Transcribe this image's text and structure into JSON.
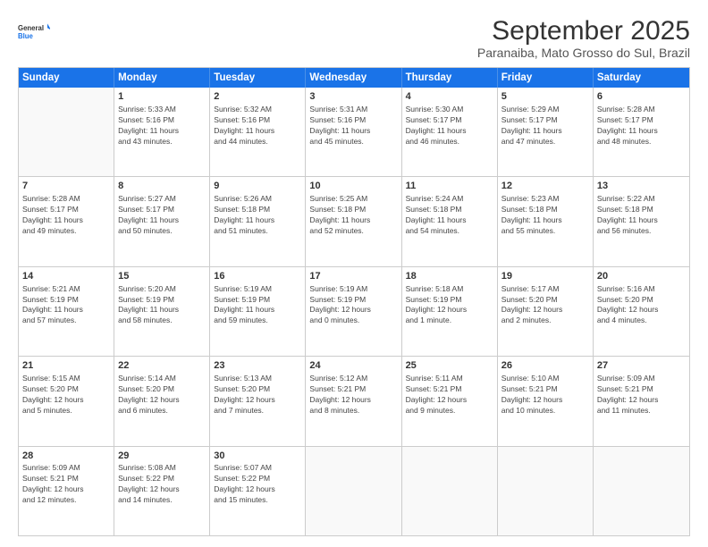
{
  "logo": {
    "line1": "General",
    "line2": "Blue"
  },
  "title": "September 2025",
  "location": "Paranaiba, Mato Grosso do Sul, Brazil",
  "header_days": [
    "Sunday",
    "Monday",
    "Tuesday",
    "Wednesday",
    "Thursday",
    "Friday",
    "Saturday"
  ],
  "weeks": [
    [
      {
        "day": "",
        "info": ""
      },
      {
        "day": "1",
        "info": "Sunrise: 5:33 AM\nSunset: 5:16 PM\nDaylight: 11 hours\nand 43 minutes."
      },
      {
        "day": "2",
        "info": "Sunrise: 5:32 AM\nSunset: 5:16 PM\nDaylight: 11 hours\nand 44 minutes."
      },
      {
        "day": "3",
        "info": "Sunrise: 5:31 AM\nSunset: 5:16 PM\nDaylight: 11 hours\nand 45 minutes."
      },
      {
        "day": "4",
        "info": "Sunrise: 5:30 AM\nSunset: 5:17 PM\nDaylight: 11 hours\nand 46 minutes."
      },
      {
        "day": "5",
        "info": "Sunrise: 5:29 AM\nSunset: 5:17 PM\nDaylight: 11 hours\nand 47 minutes."
      },
      {
        "day": "6",
        "info": "Sunrise: 5:28 AM\nSunset: 5:17 PM\nDaylight: 11 hours\nand 48 minutes."
      }
    ],
    [
      {
        "day": "7",
        "info": "Sunrise: 5:28 AM\nSunset: 5:17 PM\nDaylight: 11 hours\nand 49 minutes."
      },
      {
        "day": "8",
        "info": "Sunrise: 5:27 AM\nSunset: 5:17 PM\nDaylight: 11 hours\nand 50 minutes."
      },
      {
        "day": "9",
        "info": "Sunrise: 5:26 AM\nSunset: 5:18 PM\nDaylight: 11 hours\nand 51 minutes."
      },
      {
        "day": "10",
        "info": "Sunrise: 5:25 AM\nSunset: 5:18 PM\nDaylight: 11 hours\nand 52 minutes."
      },
      {
        "day": "11",
        "info": "Sunrise: 5:24 AM\nSunset: 5:18 PM\nDaylight: 11 hours\nand 54 minutes."
      },
      {
        "day": "12",
        "info": "Sunrise: 5:23 AM\nSunset: 5:18 PM\nDaylight: 11 hours\nand 55 minutes."
      },
      {
        "day": "13",
        "info": "Sunrise: 5:22 AM\nSunset: 5:18 PM\nDaylight: 11 hours\nand 56 minutes."
      }
    ],
    [
      {
        "day": "14",
        "info": "Sunrise: 5:21 AM\nSunset: 5:19 PM\nDaylight: 11 hours\nand 57 minutes."
      },
      {
        "day": "15",
        "info": "Sunrise: 5:20 AM\nSunset: 5:19 PM\nDaylight: 11 hours\nand 58 minutes."
      },
      {
        "day": "16",
        "info": "Sunrise: 5:19 AM\nSunset: 5:19 PM\nDaylight: 11 hours\nand 59 minutes."
      },
      {
        "day": "17",
        "info": "Sunrise: 5:19 AM\nSunset: 5:19 PM\nDaylight: 12 hours\nand 0 minutes."
      },
      {
        "day": "18",
        "info": "Sunrise: 5:18 AM\nSunset: 5:19 PM\nDaylight: 12 hours\nand 1 minute."
      },
      {
        "day": "19",
        "info": "Sunrise: 5:17 AM\nSunset: 5:20 PM\nDaylight: 12 hours\nand 2 minutes."
      },
      {
        "day": "20",
        "info": "Sunrise: 5:16 AM\nSunset: 5:20 PM\nDaylight: 12 hours\nand 4 minutes."
      }
    ],
    [
      {
        "day": "21",
        "info": "Sunrise: 5:15 AM\nSunset: 5:20 PM\nDaylight: 12 hours\nand 5 minutes."
      },
      {
        "day": "22",
        "info": "Sunrise: 5:14 AM\nSunset: 5:20 PM\nDaylight: 12 hours\nand 6 minutes."
      },
      {
        "day": "23",
        "info": "Sunrise: 5:13 AM\nSunset: 5:20 PM\nDaylight: 12 hours\nand 7 minutes."
      },
      {
        "day": "24",
        "info": "Sunrise: 5:12 AM\nSunset: 5:21 PM\nDaylight: 12 hours\nand 8 minutes."
      },
      {
        "day": "25",
        "info": "Sunrise: 5:11 AM\nSunset: 5:21 PM\nDaylight: 12 hours\nand 9 minutes."
      },
      {
        "day": "26",
        "info": "Sunrise: 5:10 AM\nSunset: 5:21 PM\nDaylight: 12 hours\nand 10 minutes."
      },
      {
        "day": "27",
        "info": "Sunrise: 5:09 AM\nSunset: 5:21 PM\nDaylight: 12 hours\nand 11 minutes."
      }
    ],
    [
      {
        "day": "28",
        "info": "Sunrise: 5:09 AM\nSunset: 5:21 PM\nDaylight: 12 hours\nand 12 minutes."
      },
      {
        "day": "29",
        "info": "Sunrise: 5:08 AM\nSunset: 5:22 PM\nDaylight: 12 hours\nand 14 minutes."
      },
      {
        "day": "30",
        "info": "Sunrise: 5:07 AM\nSunset: 5:22 PM\nDaylight: 12 hours\nand 15 minutes."
      },
      {
        "day": "",
        "info": ""
      },
      {
        "day": "",
        "info": ""
      },
      {
        "day": "",
        "info": ""
      },
      {
        "day": "",
        "info": ""
      }
    ]
  ]
}
